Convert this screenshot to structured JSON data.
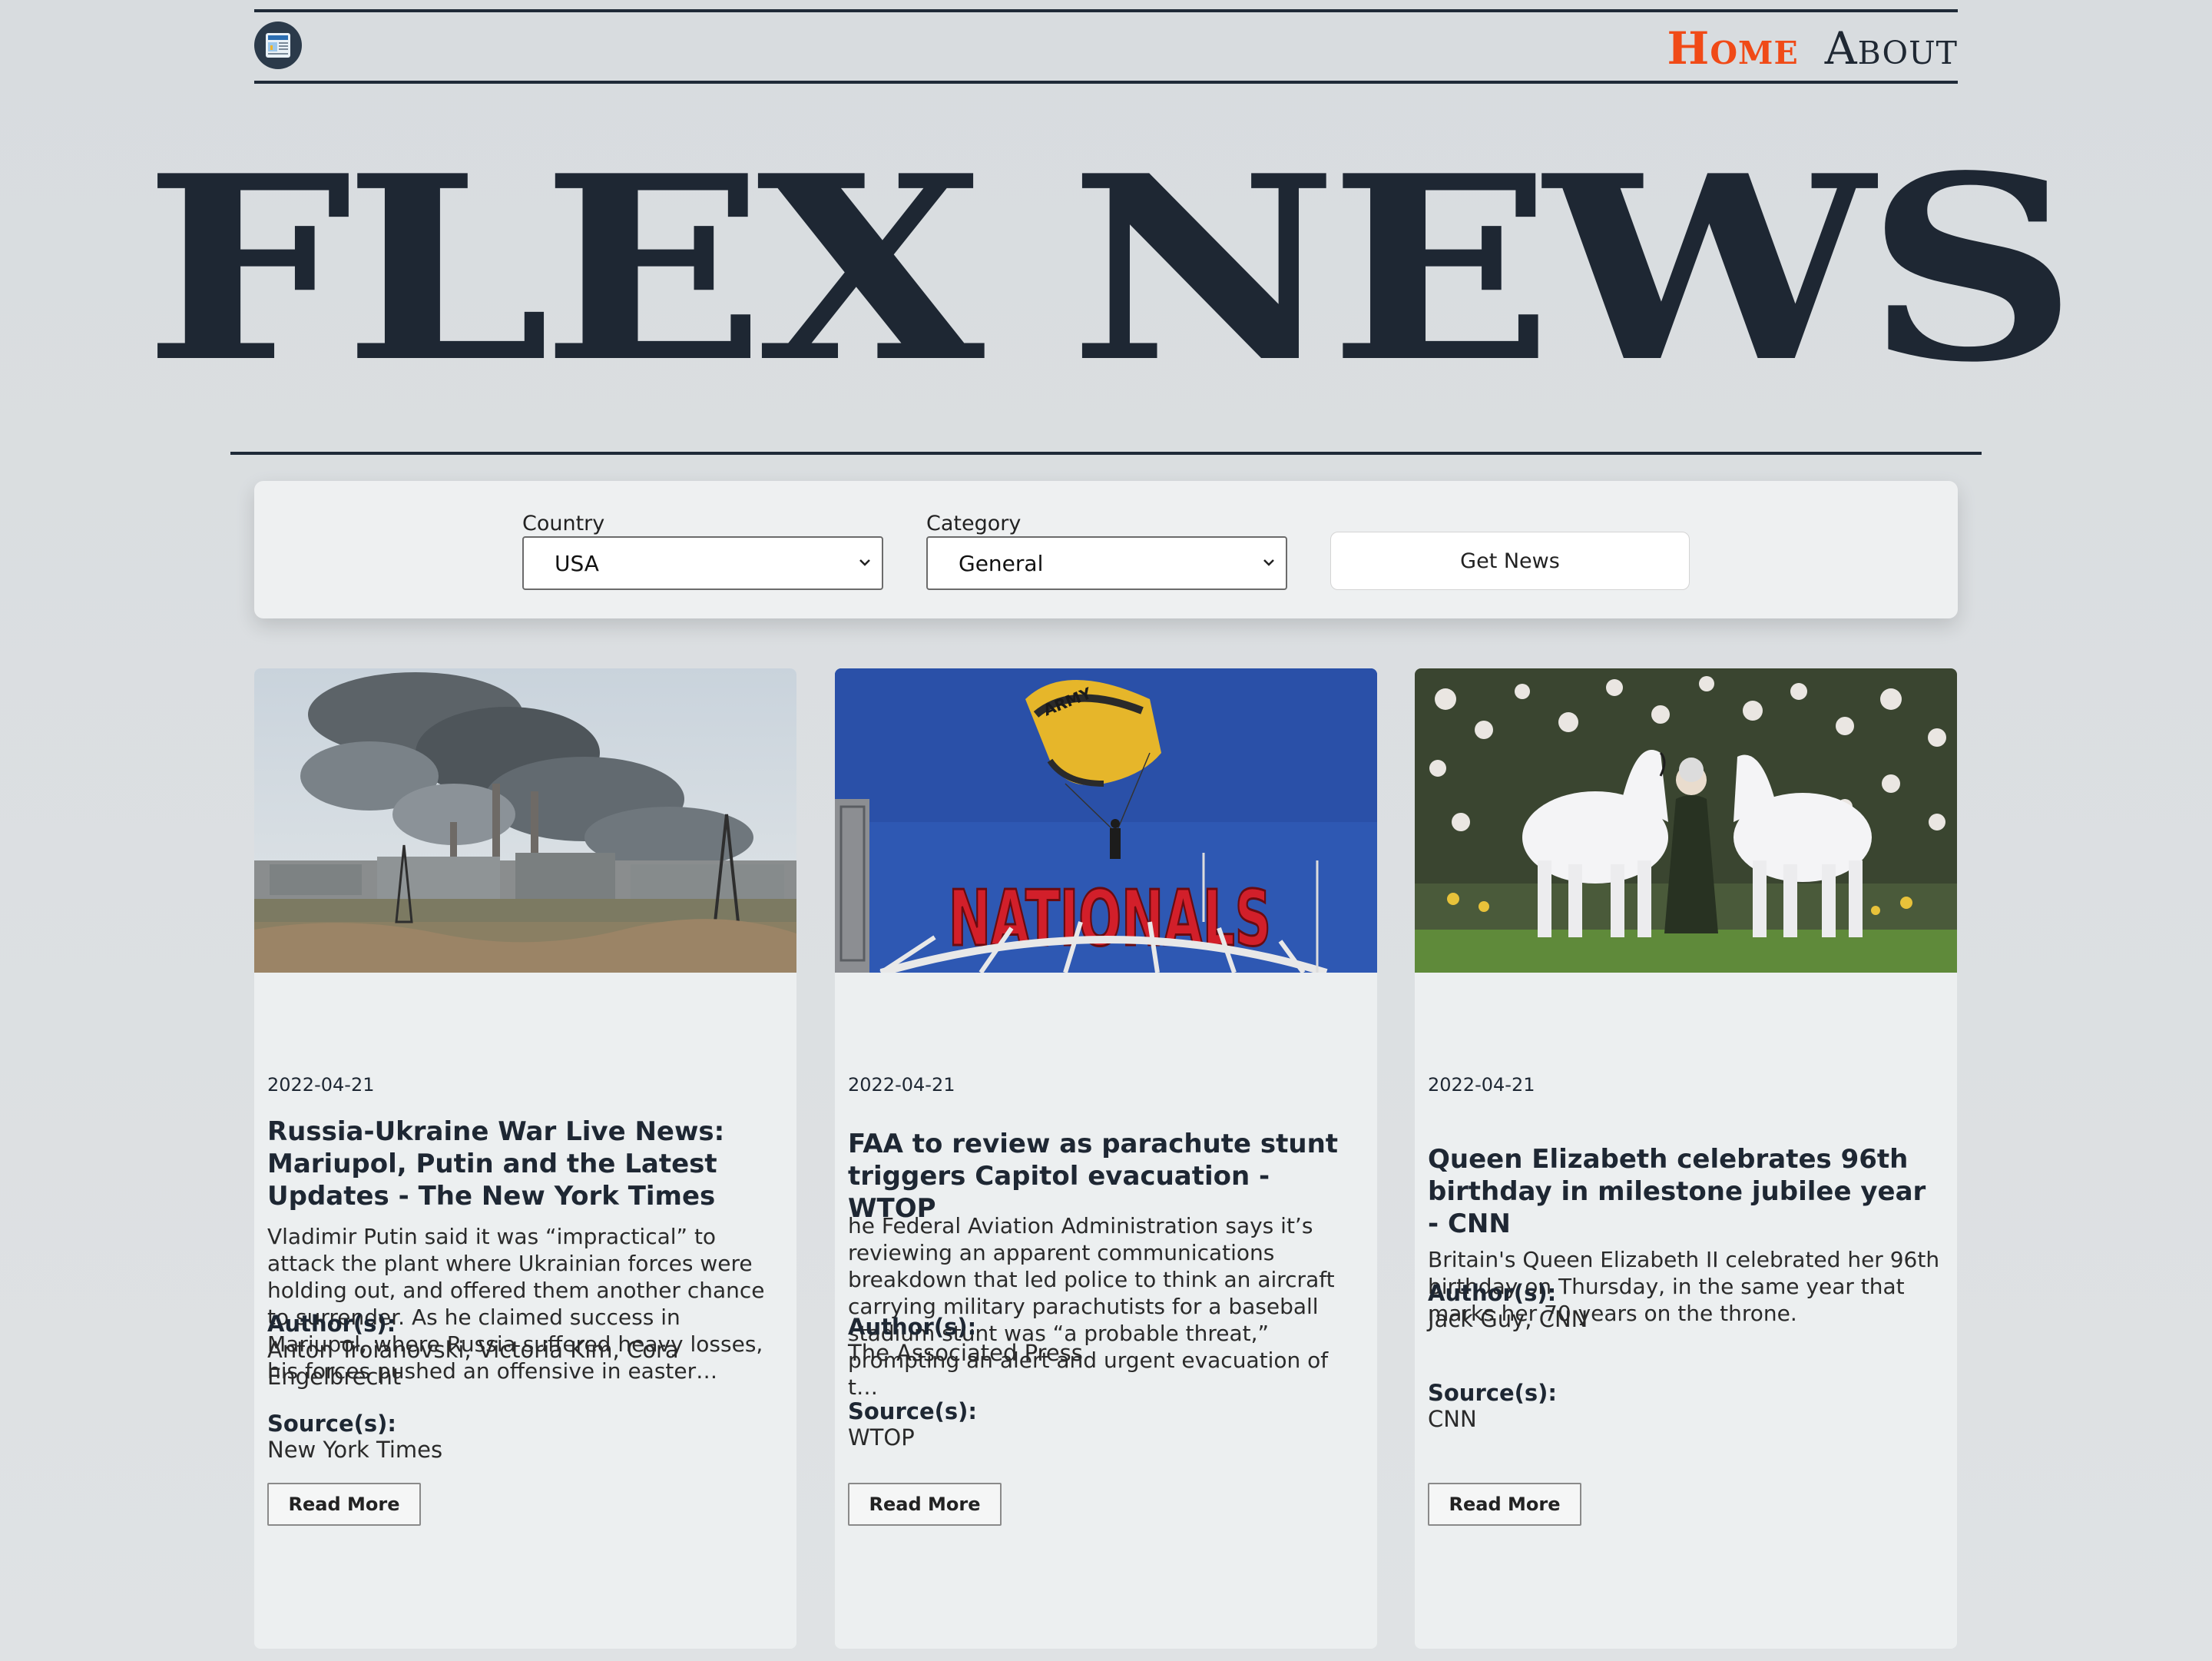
{
  "nav": {
    "logo_icon": "newspaper-icon",
    "links": [
      "Home",
      "About"
    ],
    "active_color": "#f04a17"
  },
  "masthead": {
    "title": "FLEX NEWS"
  },
  "filters": {
    "country_label": "Country",
    "country_value": "USA",
    "category_label": "Category",
    "category_value": "General",
    "submit_label": "Get News"
  },
  "articles": [
    {
      "image": "smoke-over-steel-plant",
      "date": "2022-04-21",
      "title": "Russia-Ukraine War Live News: Mariupol, Putin and the Latest Updates - The New York Times",
      "description": "Vladimir Putin said it was “impractical” to attack the plant where Ukrainian forces were holding out, and offered them another chance to surrender. As he claimed success in Mariupol, where Russia suffered heavy losses, his forces pushed an offensive in easter…",
      "author_label": "Author(s):",
      "authors": "Anton Troianovski, Victoria Kim, Cora Engelbrecht",
      "source_label": "Source(s):",
      "source": "New York Times",
      "button": "Read More"
    },
    {
      "image": "parachutist-over-nationals-sign",
      "date": "2022-04-21",
      "title": "FAA to review as parachute stunt triggers Capitol evacuation - WTOP",
      "description": "he Federal Aviation Administration says it’s reviewing an apparent communications breakdown that led police to think an aircraft carrying military parachutists for a baseball stadium stunt was “a probable threat,” prompting an alert and urgent evacuation of t…",
      "author_label": "Author(s):",
      "authors": "The Associated Press",
      "source_label": "Source(s):",
      "source": "WTOP",
      "button": "Read More"
    },
    {
      "image": "queen-with-white-ponies",
      "date": "2022-04-21",
      "title": "Queen Elizabeth celebrates 96th birthday in milestone jubilee year - CNN",
      "description": "Britain's Queen Elizabeth II celebrated her 96th birthday on Thursday, in the same year that marks her 70 years on the throne.",
      "author_label": "Author(s):",
      "authors": "Jack Guy, CNN",
      "source_label": "Source(s):",
      "source": "CNN",
      "button": "Read More"
    }
  ],
  "image_text": {
    "canopy": "ARMY",
    "stadium_sign": "NATIONALS"
  }
}
